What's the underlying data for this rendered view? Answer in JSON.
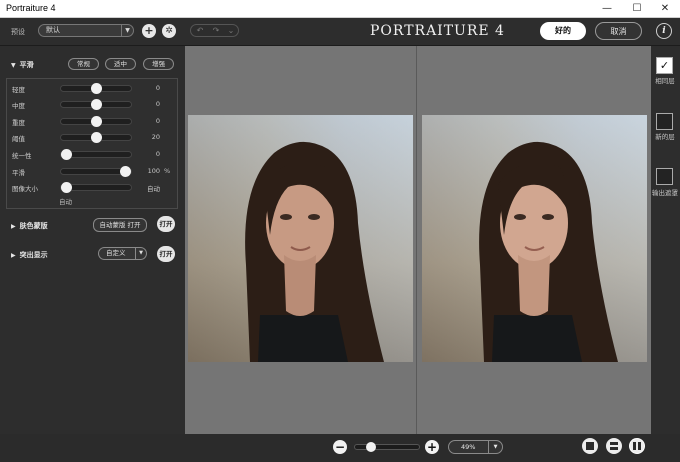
{
  "window": {
    "title": "Portraiture 4",
    "minimize": "—",
    "maximize": "☐",
    "close": "✕"
  },
  "toolbar": {
    "preset_label": "预设",
    "preset_value": "默认",
    "undo": "↶",
    "redo": "↷",
    "history_dropdown": "⌄",
    "brand": "PORTRAITURE 4",
    "ok_label": "好的",
    "cancel_label": "取消",
    "info_label": "i"
  },
  "smoothing": {
    "title": "平滑",
    "presets": [
      "常规",
      "适中",
      "增强"
    ],
    "sliders": [
      {
        "label": "轻度",
        "value": "0",
        "level": 0.5
      },
      {
        "label": "中度",
        "value": "0",
        "level": 0.5
      },
      {
        "label": "重度",
        "value": "0",
        "level": 0.5
      },
      {
        "label": "阈值",
        "value": "20",
        "level": 0.5
      },
      {
        "label": "统一性",
        "value": "0",
        "level": 0.0
      },
      {
        "label": "平滑",
        "value": "100",
        "unit": "%",
        "level": 1.0
      },
      {
        "label": "图像大小",
        "value": "自动",
        "level": 0.0
      }
    ],
    "auto_note": "自动"
  },
  "skin_mask": {
    "title": "肤色蒙版",
    "auto_label": "自动蒙版 打开",
    "toggle_label": "打开"
  },
  "enhance": {
    "title": "突出显示",
    "combo_value": "自定义",
    "toggle_label": "打开"
  },
  "output": {
    "same_layer": {
      "label": "相同层",
      "checked": true,
      "mark": "✓"
    },
    "new_layer": {
      "label": "新的层",
      "checked": false
    },
    "output_mask": {
      "label": "输出遮罩",
      "checked": false
    }
  },
  "zoom": {
    "minus": "−",
    "plus": "+",
    "value": "49%",
    "level": 0.2
  }
}
